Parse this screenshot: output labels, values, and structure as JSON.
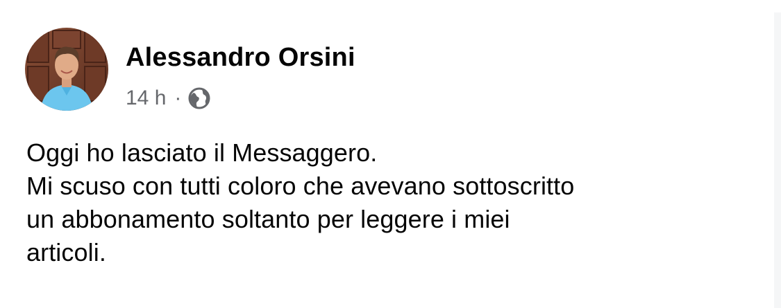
{
  "post": {
    "author": {
      "name": "Alessandro Orsini",
      "avatar_icon": "person-avatar"
    },
    "timestamp": "14 h",
    "separator": "·",
    "visibility_icon": "globe-icon",
    "text_lines": [
      "Oggi ho lasciato il Messaggero.",
      "Mi scuso con tutti coloro che avevano sottoscritto",
      "un abbonamento soltanto per leggere i miei",
      "articoli."
    ]
  },
  "colors": {
    "name": "#050505",
    "meta": "#65676b",
    "body": "#050505",
    "background": "#ffffff"
  }
}
